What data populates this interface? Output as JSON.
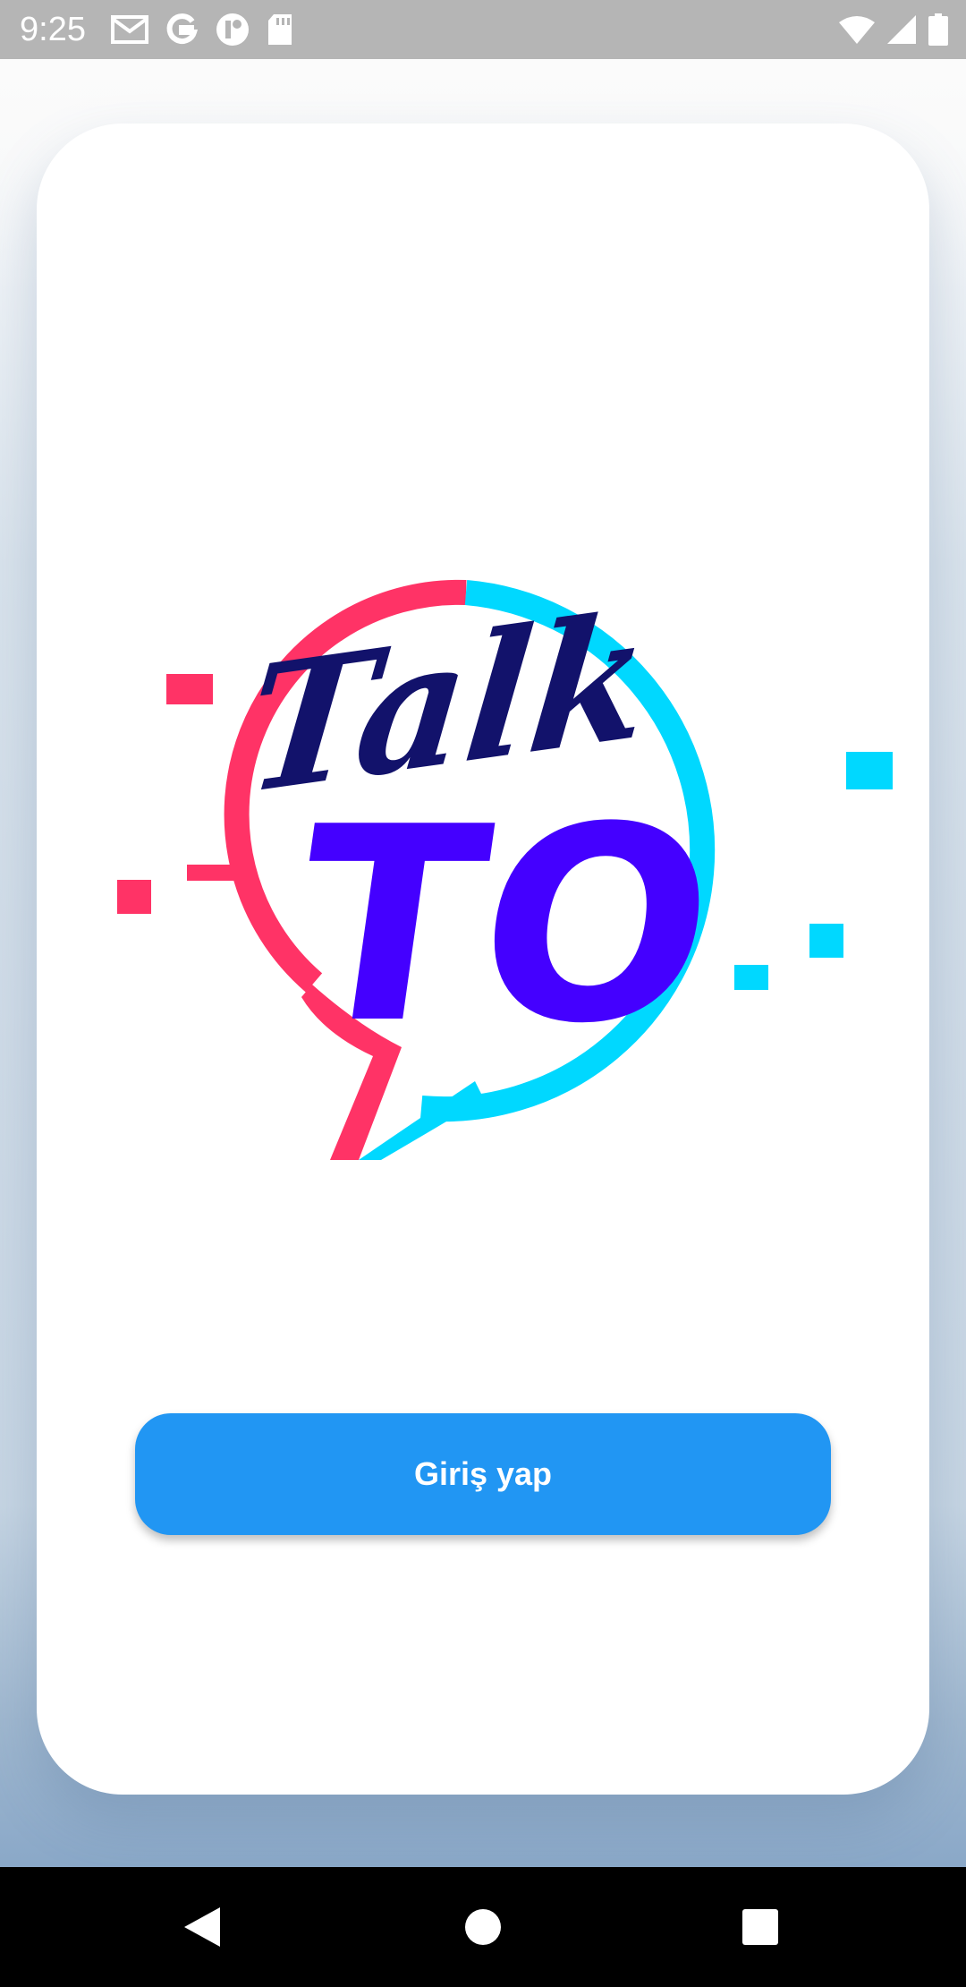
{
  "status_bar": {
    "time": "9:25",
    "left_icons": [
      "gmail-icon",
      "google-icon",
      "app-notification-icon",
      "sd-card-icon"
    ],
    "right_icons": [
      "wifi-icon",
      "cell-signal-icon",
      "battery-icon"
    ]
  },
  "logo": {
    "word_top": "Talk",
    "word_bottom": "TO",
    "colors": {
      "bubble_left": "#ff3366",
      "bubble_right": "#00d8ff",
      "talk_text": "#12126b",
      "to_text": "#4400ff"
    }
  },
  "login_button": {
    "label": "Giriş yap",
    "color": "#2196f3"
  },
  "nav_bar": {
    "buttons": [
      "back-icon",
      "home-icon",
      "recents-icon"
    ]
  }
}
